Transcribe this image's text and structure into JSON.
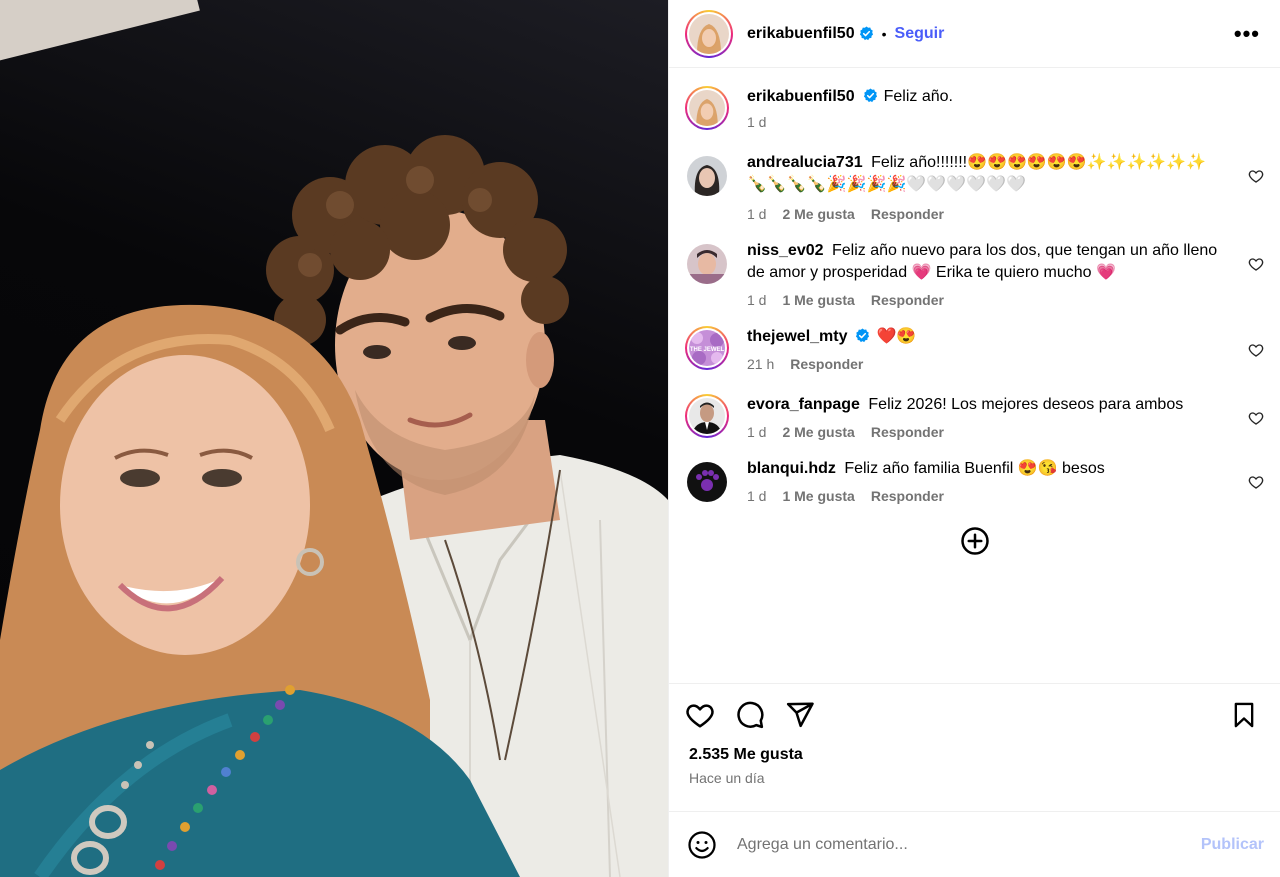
{
  "post": {
    "author": "erikabuenfil50",
    "follow_label": "Seguir",
    "dot": "•",
    "more_label": "•••"
  },
  "caption": {
    "username": "erikabuenfil50",
    "text": "Feliz año.",
    "time": "1 d"
  },
  "comments": [
    {
      "username": "andrealucia731",
      "text": "Feliz año!!!!!!!😍😍😍😍😍😍✨✨✨✨✨✨🍾🍾🍾🍾🎉🎉🎉🎉🤍🤍🤍🤍🤍🤍",
      "time": "1 d",
      "likes": "2 Me gusta",
      "reply": "Responder"
    },
    {
      "username": "niss_ev02",
      "text": "Feliz año nuevo para los dos, que tengan un año lleno de amor y prosperidad 💗 Erika te quiero mucho 💗",
      "time": "1 d",
      "likes": "1 Me gusta",
      "reply": "Responder"
    },
    {
      "username": "thejewel_mty",
      "text": "❤️😍",
      "time": "21 h",
      "reply": "Responder",
      "avatar_text": "THE JEWEL"
    },
    {
      "username": "evora_fanpage",
      "text": "Feliz 2026! Los mejores deseos para ambos",
      "time": "1 d",
      "likes": "2 Me gusta",
      "reply": "Responder"
    },
    {
      "username": "blanqui.hdz",
      "text": "Feliz año familia Buenfil 😍😘 besos",
      "time": "1 d",
      "likes": "1 Me gusta",
      "reply": "Responder"
    }
  ],
  "footer": {
    "likes": "2.535 Me gusta",
    "when": "Hace un día",
    "comment_placeholder": "Agrega un comentario...",
    "publish_label": "Publicar"
  },
  "colors": {
    "verified": "#0095f6",
    "follow": "#4a5df9",
    "publish_disabled": "#b3c3fa",
    "muted": "#737373"
  }
}
